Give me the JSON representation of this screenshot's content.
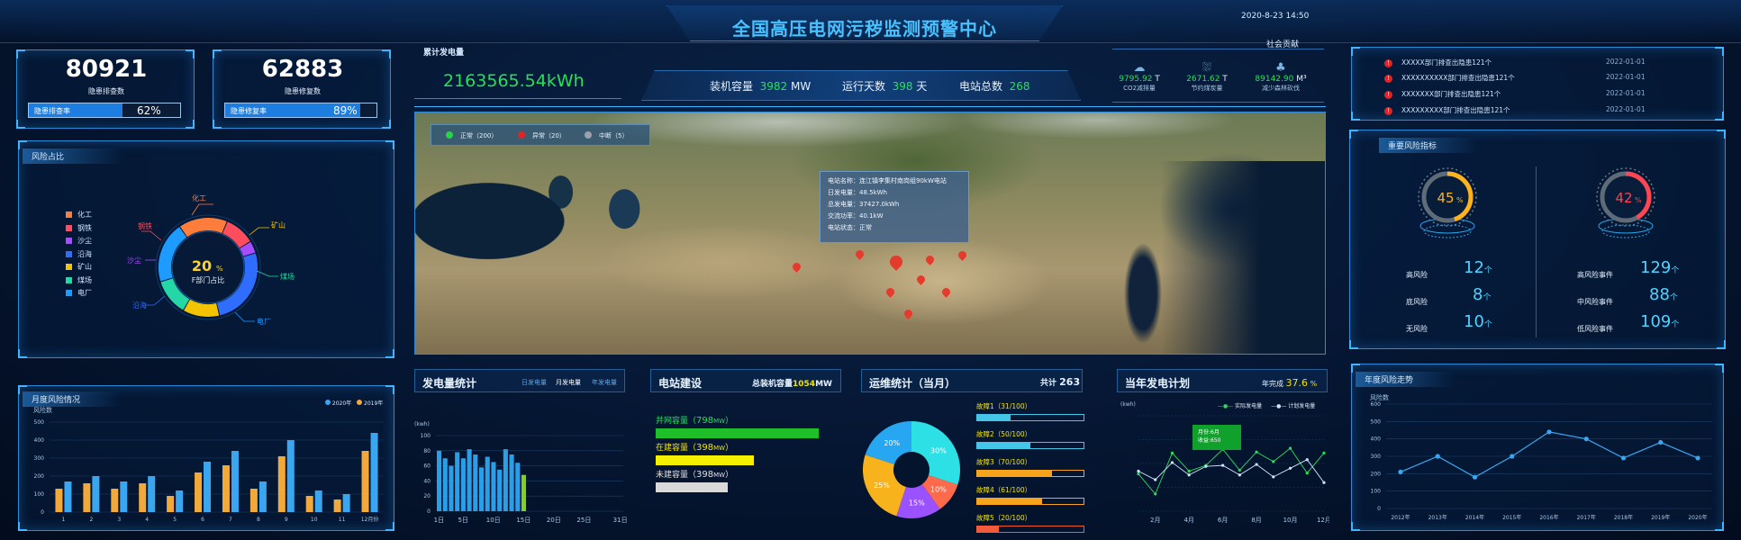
{
  "header": {
    "title": "全国高压电网污秽监测预警中心",
    "datetime": "2020-8-23 14:50"
  },
  "stats_left": [
    {
      "value": "80921",
      "label": "隐患排查数",
      "bar_label": "隐患排查率",
      "percent": "62%",
      "fill": 0.62
    },
    {
      "value": "62883",
      "label": "隐患修复数",
      "bar_label": "隐患修复率",
      "percent": "89%",
      "fill": 0.89
    }
  ],
  "risk_share": {
    "title": "风险占比",
    "legend": [
      {
        "name": "化工",
        "color": "#ff7d3a"
      },
      {
        "name": "钢铁",
        "color": "#ff4d5e"
      },
      {
        "name": "沙尘",
        "color": "#a64dff"
      },
      {
        "name": "沿海",
        "color": "#2f6dff"
      },
      {
        "name": "矿山",
        "color": "#f5c400"
      },
      {
        "name": "煤场",
        "color": "#25d7a6"
      },
      {
        "name": "电厂",
        "color": "#1e9bff"
      }
    ],
    "center_value": "20",
    "center_unit": "%",
    "center_label": "F部门占比",
    "labels": {
      "huagong": "化工",
      "gangtie": "钢铁",
      "kuangshan": "矿山",
      "shachen": "沙尘",
      "meichang": "煤场",
      "yanhai": "沿海",
      "dianchang": "电厂"
    }
  },
  "monthly_risk": {
    "title": "月度风险情况",
    "ylabel": "风险数",
    "legend": [
      {
        "name": "2020年",
        "color": "#3aa6f0"
      },
      {
        "name": "2019年",
        "color": "#f2a93b"
      }
    ],
    "y_ticks": [
      "0",
      "100",
      "200",
      "300",
      "400",
      "500"
    ],
    "x_ticks": [
      "1",
      "2",
      "3",
      "4",
      "5",
      "6",
      "7",
      "8",
      "9",
      "10",
      "11",
      "12月份"
    ]
  },
  "cumulative": {
    "label": "累计发电量",
    "value": "2163565.54kWh"
  },
  "capacity_bar": {
    "items": [
      {
        "label": "装机容量",
        "value": "3982",
        "unit": "MW"
      },
      {
        "label": "运行天数",
        "value": "398",
        "unit": "天"
      },
      {
        "label": "电站总数",
        "value": "268",
        "unit": ""
      }
    ]
  },
  "social": {
    "title": "社会贡献",
    "items": [
      {
        "icon": "cloud-icon",
        "value": "9795.92",
        "unit": "T",
        "label": "CO2减排量"
      },
      {
        "icon": "coal-icon",
        "value": "2671.62",
        "unit": "T",
        "label": "节约煤炭量"
      },
      {
        "icon": "tree-icon",
        "value": "89142.90",
        "unit": "M³",
        "label": "减少森林砍伐"
      }
    ]
  },
  "map": {
    "legend": [
      {
        "name": "正常（200）",
        "color": "#26d34a"
      },
      {
        "name": "异常（20）",
        "color": "#e02424"
      },
      {
        "name": "中断（5）",
        "color": "#9aa3ad"
      }
    ],
    "tooltip": [
      "电站名称：连江镇李集村南岗组90kW电站",
      "日发电量：48.5kWh",
      "总发电量：37427.0kWh",
      "交流功率：40.1kW",
      "电站状态：正常"
    ]
  },
  "alerts": [
    {
      "text": "XXXXX部门排查出隐患121个",
      "date": "2022-01-01"
    },
    {
      "text": "XXXXXXXXXX部门排查出隐患121个",
      "date": "2022-01-01"
    },
    {
      "text": "XXXXXXX部门排查出隐患121个",
      "date": "2022-01-01"
    },
    {
      "text": "XXXXXXXXX部门排查出隐患121个",
      "date": "2022-01-01"
    }
  ],
  "key_risk": {
    "title": "重要风险指标",
    "gauges": [
      {
        "value": "45",
        "unit": "%",
        "fraction": 0.45,
        "color": "#ffb21a"
      },
      {
        "value": "42",
        "unit": "%",
        "fraction": 0.42,
        "color": "#ff4452"
      }
    ],
    "left_rows": [
      {
        "label": "高风险",
        "value": "12",
        "unit": "个"
      },
      {
        "label": "底风险",
        "value": "8",
        "unit": "个"
      },
      {
        "label": "无风险",
        "value": "10",
        "unit": "个"
      }
    ],
    "right_rows": [
      {
        "label": "高风险事件",
        "value": "129",
        "unit": "个"
      },
      {
        "label": "中风险事件",
        "value": "88",
        "unit": "个"
      },
      {
        "label": "低风险事件",
        "value": "109",
        "unit": "个"
      }
    ]
  },
  "power_stats": {
    "title": "发电量统计",
    "tabs": [
      "日发电量",
      "月发电量",
      "年发电量"
    ],
    "unit": "(kwh)",
    "y_ticks": [
      "0",
      "20",
      "40",
      "60",
      "80",
      "100"
    ],
    "x_ticks": [
      "1日",
      "5日",
      "10日",
      "15日",
      "20日",
      "25日",
      "31日"
    ]
  },
  "construction": {
    "title": "电站建设",
    "total_label": "总装机容量",
    "total_value": "1054",
    "total_unit": "MW",
    "bars": [
      {
        "label": "并网容量",
        "value": "798",
        "unit": "MW",
        "color": "#1fbf2a",
        "text_color": "#26e05a",
        "fill": 0.86
      },
      {
        "label": "在建容量",
        "value": "398",
        "unit": "MW",
        "color": "#f5f000",
        "text_color": "#f5e400",
        "fill": 0.52
      },
      {
        "label": "未建容量",
        "value": "398",
        "unit": "MW",
        "color": "#d9d9d9",
        "text_color": "#e0e0e0",
        "fill": 0.38
      }
    ]
  },
  "ops": {
    "title": "运维统计（当月）",
    "total_label": "共计",
    "total_value": "263",
    "pie": [
      {
        "label": "30%",
        "value": 30,
        "color": "#2de0e6"
      },
      {
        "label": "10%",
        "value": 10,
        "color": "#ff6a4d"
      },
      {
        "label": "15%",
        "value": 15,
        "color": "#9a52ff"
      },
      {
        "label": "25%",
        "value": 25,
        "color": "#f7b21c"
      },
      {
        "label": "20%",
        "value": 20,
        "color": "#27a6f2"
      }
    ],
    "faults": [
      {
        "label": "故障1（31/100）",
        "fill": 0.31,
        "color": "#44c6e8"
      },
      {
        "label": "故障2（50/100）",
        "fill": 0.5,
        "color": "#44c6e8"
      },
      {
        "label": "故障3（70/100）",
        "fill": 0.7,
        "color": "#f7a41c"
      },
      {
        "label": "故障4（61/100）",
        "fill": 0.61,
        "color": "#f7a41c"
      },
      {
        "label": "故障5（20/100）",
        "fill": 0.2,
        "color": "#f25a3a"
      }
    ]
  },
  "plan": {
    "title": "当年发电计划",
    "done_label": "年完成",
    "done_value": "37.6",
    "done_unit": "%",
    "unit": "(kwh)",
    "legend": [
      "实际发电量",
      "计划发电量"
    ],
    "tooltip": [
      "月份:6月",
      "收益:650"
    ],
    "x_ticks": [
      "2月",
      "4月",
      "6月",
      "8月",
      "10月",
      "12月"
    ]
  },
  "annual_risk": {
    "title": "年度风险走势",
    "ylabel": "风险数",
    "y_ticks": [
      "0",
      "100",
      "200",
      "300",
      "400",
      "500",
      "600"
    ],
    "x_ticks": [
      "2012年",
      "2013年",
      "2014年",
      "2015年",
      "2016年",
      "2017年",
      "2018年",
      "2019年",
      "2020年"
    ]
  },
  "chart_data": [
    {
      "type": "pie",
      "title": "风险占比",
      "categories": [
        "化工",
        "钢铁",
        "沙尘",
        "沿海",
        "矿山",
        "煤场",
        "电厂"
      ],
      "values": [
        16,
        10,
        4,
        26,
        12,
        12,
        20
      ]
    },
    {
      "type": "bar",
      "title": "月度风险情况",
      "categories": [
        "1",
        "2",
        "3",
        "4",
        "5",
        "6",
        "7",
        "8",
        "9",
        "10",
        "11",
        "12"
      ],
      "series": [
        {
          "name": "2019年",
          "values": [
            130,
            160,
            130,
            160,
            90,
            220,
            260,
            130,
            310,
            90,
            70,
            340
          ]
        },
        {
          "name": "2020年",
          "values": [
            170,
            200,
            170,
            200,
            120,
            280,
            340,
            170,
            400,
            120,
            100,
            440
          ]
        }
      ],
      "ylim": [
        0,
        500
      ]
    },
    {
      "type": "bar",
      "title": "发电量统计",
      "ylabel": "(kwh)",
      "categories": [
        "1",
        "2",
        "3",
        "4",
        "5",
        "6",
        "7",
        "8",
        "9",
        "10",
        "11",
        "12",
        "13",
        "14",
        "15"
      ],
      "values": [
        80,
        70,
        60,
        78,
        70,
        82,
        75,
        58,
        72,
        65,
        55,
        82,
        75,
        64,
        48
      ],
      "ylim": [
        0,
        100
      ]
    },
    {
      "type": "pie",
      "title": "运维统计（当月）",
      "categories": [
        "30%",
        "10%",
        "15%",
        "25%",
        "20%"
      ],
      "values": [
        30,
        10,
        15,
        25,
        20
      ]
    },
    {
      "type": "line",
      "title": "当年发电计划",
      "x": [
        1,
        2,
        3,
        4,
        5,
        6,
        7,
        8,
        9,
        10,
        11,
        12
      ],
      "series": [
        {
          "name": "实际发电量",
          "values": [
            390,
            180,
            610,
            420,
            480,
            650,
            430,
            620,
            520,
            660,
            400,
            610
          ]
        },
        {
          "name": "计划发电量",
          "values": [
            420,
            330,
            510,
            380,
            470,
            480,
            380,
            490,
            360,
            450,
            540,
            300
          ]
        }
      ],
      "ylim": [
        0,
        1000
      ]
    },
    {
      "type": "line",
      "title": "年度风险走势",
      "ylabel": "风险数",
      "categories": [
        "2012年",
        "2013年",
        "2014年",
        "2015年",
        "2016年",
        "2017年",
        "2018年",
        "2019年",
        "2020年"
      ],
      "values": [
        210,
        300,
        180,
        300,
        440,
        400,
        290,
        380,
        290
      ],
      "ylim": [
        0,
        600
      ]
    }
  ]
}
